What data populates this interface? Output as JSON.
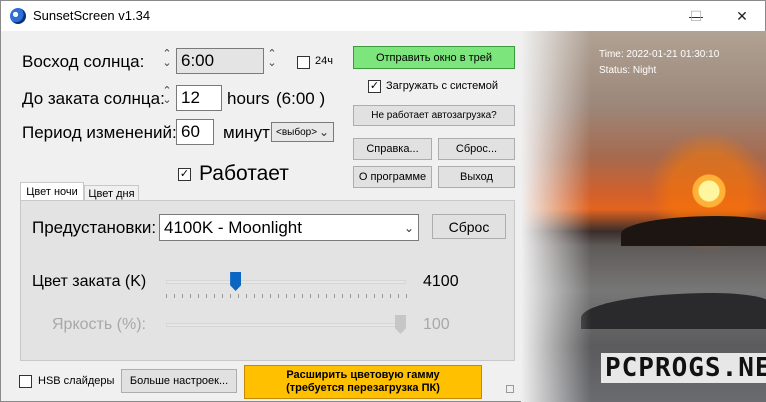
{
  "window": {
    "title": "SunsetScreen v1.34",
    "minimize": "—",
    "maximize": "☐",
    "close": "✕"
  },
  "sunrise": {
    "label": "Восход солнца:",
    "value": "6:00",
    "h24_label": "24ч"
  },
  "sunset_until": {
    "label": "До заката солнца:",
    "value": "12",
    "unit": "hours",
    "hint": "(6:00 )"
  },
  "period": {
    "label": "Период изменений:",
    "value": "60",
    "unit": "минут",
    "select_value": "<выбор>"
  },
  "buttons": {
    "send_to_tray": "Отправить окно в трей",
    "autostart_broken": "Не работает автозагрузка?",
    "help": "Справка...",
    "reset_top": "Сброс...",
    "about": "О программе",
    "exit": "Выход",
    "more_settings": "Больше настроек...",
    "extend_gamut_line1": "Расширить цветовую гамму",
    "extend_gamut_line2": "(требуется перезагрузка ПК)"
  },
  "load_with_system": {
    "label": "Загружать с системой",
    "checked": true
  },
  "running": {
    "label": "Работает",
    "checked": true
  },
  "tabs": [
    {
      "label": "Цвет ночи",
      "active": true
    },
    {
      "label": "Цвет дня",
      "active": false
    }
  ],
  "presets": {
    "label": "Предустановки:",
    "value": "4100K - Moonlight",
    "reset": "Сброс"
  },
  "sunset_color": {
    "label": "Цвет заката (K)",
    "value": "4100",
    "slider_fraction": 0.28
  },
  "brightness": {
    "label": "Яркость (%):",
    "value": "100",
    "slider_fraction": 1.0,
    "disabled": true
  },
  "hsb": {
    "label": "HSB слайдеры",
    "checked": false
  },
  "status": {
    "time": "Time: 2022-01-21 01:30:10",
    "state": "Status: Night"
  },
  "watermark": "PCPROGS.NET",
  "colors": {
    "tray_button": "#7ce57c",
    "gamut_button": "#ffc000",
    "slider_thumb": "#0a66c2"
  }
}
